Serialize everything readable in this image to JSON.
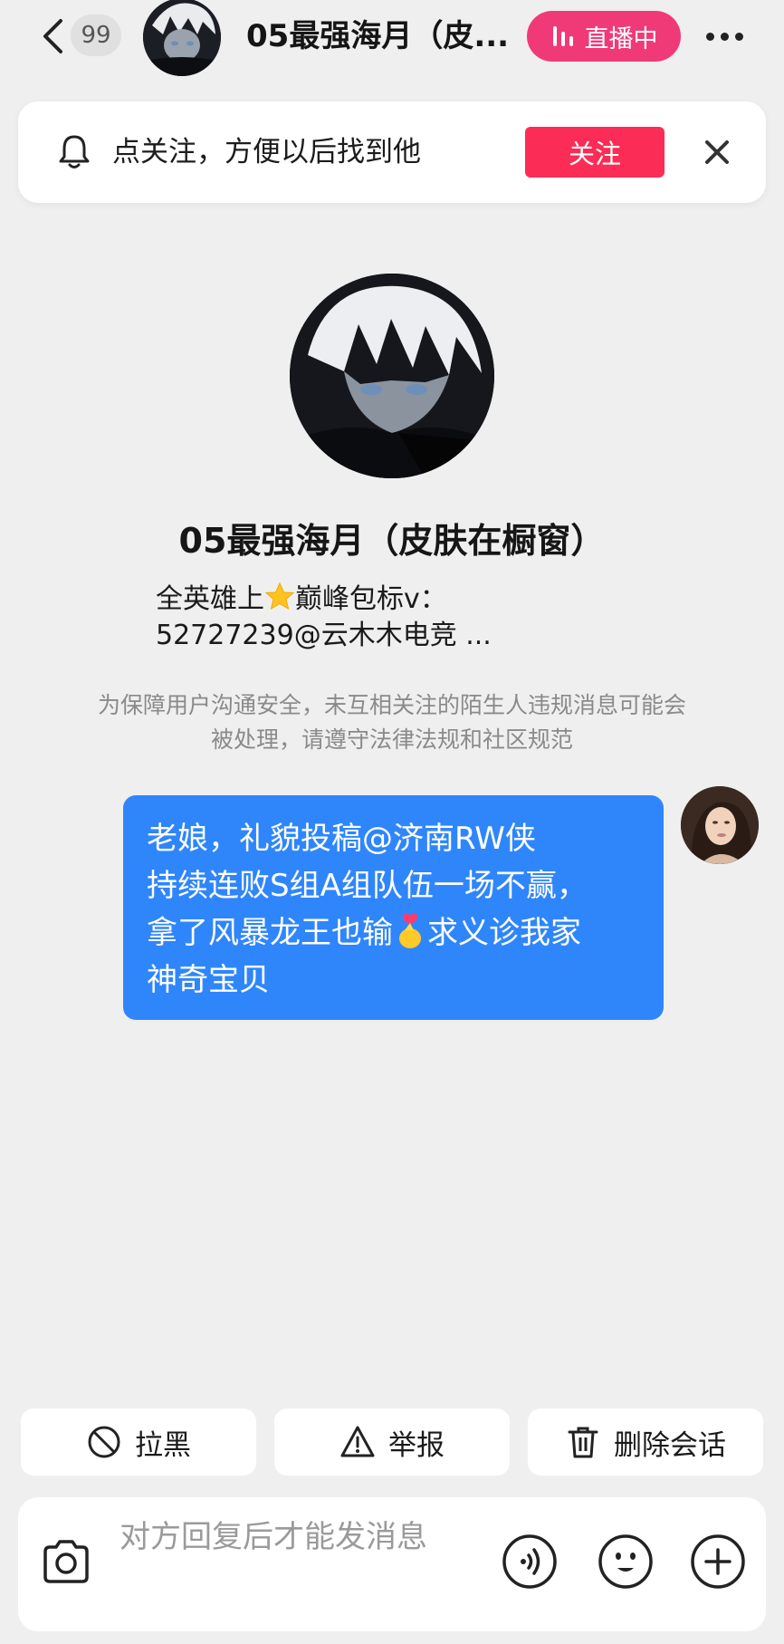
{
  "header": {
    "unread_count": "99",
    "title": "05最强海月（皮...",
    "live_label": "直播中"
  },
  "follow_banner": {
    "text": "点关注，方便以后找到他",
    "follow_label": "关注"
  },
  "profile": {
    "name": "05最强海月（皮肤在橱窗）",
    "bio_line1_prefix": "全英雄上",
    "bio_line1_suffix": "巅峰包标v：",
    "bio_line2": "52727239@云木木电竞 ..."
  },
  "notice": {
    "text": "为保障用户沟通安全，未互相关注的陌生人违规消息可能会被处理，请遵守法律法规和社区规范"
  },
  "message": {
    "line1": "老娘，礼貌投稿@济南RW侠",
    "line2": "持续连败S组A组队伍一场不赢，",
    "line3_prefix": "拿了风暴龙王也输",
    "line3_suffix": "求义诊我家",
    "line4": "神奇宝贝"
  },
  "actions": {
    "block_label": "拉黑",
    "report_label": "举报",
    "delete_label": "删除会话"
  },
  "input": {
    "placeholder": "对方回复后才能发消息"
  },
  "colors": {
    "background": "#efefef",
    "live_pill": "#f03a78",
    "follow_button": "#fb2c55",
    "message_bubble": "#2f86fb"
  },
  "icons": [
    "back-arrow-icon",
    "bell-icon",
    "close-icon",
    "star-icon",
    "finger-heart-icon",
    "block-icon",
    "warning-icon",
    "trash-icon",
    "camera-icon",
    "voice-icon",
    "emoji-icon",
    "plus-icon",
    "more-icon",
    "live-bars-icon"
  ]
}
